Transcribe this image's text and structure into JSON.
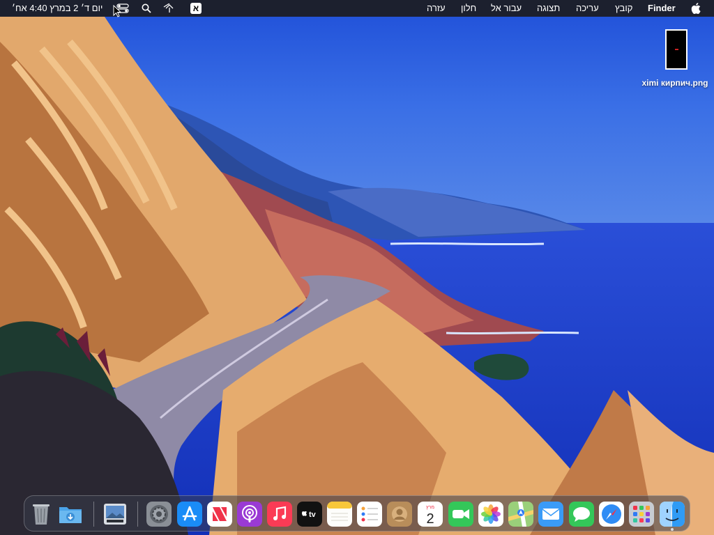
{
  "menubar": {
    "apple_icon": "apple-logo-icon",
    "app_name": "Finder",
    "menus": [
      "קובץ",
      "עריכה",
      "תצוגה",
      "עבור אל",
      "חלון",
      "עזרה"
    ],
    "input_source": "א",
    "clock": "יום ד׳ 2 במרץ 4:40 אח׳",
    "status_icons": [
      "control-center-icon",
      "search-icon",
      "wifi-icon",
      "input-source-icon"
    ]
  },
  "desktop": {
    "file_name": "ximi кирпич.png"
  },
  "dock": {
    "calendar_month": "מרץ",
    "calendar_day": "2",
    "tv_label": "tv",
    "apps": [
      {
        "name": "Finder",
        "icon": "finder-icon",
        "running": true
      },
      {
        "name": "Launchpad",
        "icon": "launchpad-icon"
      },
      {
        "name": "Safari",
        "icon": "safari-icon"
      },
      {
        "name": "Messages",
        "icon": "messages-icon"
      },
      {
        "name": "Mail",
        "icon": "mail-icon"
      },
      {
        "name": "Maps",
        "icon": "maps-icon"
      },
      {
        "name": "Photos",
        "icon": "photos-icon"
      },
      {
        "name": "FaceTime",
        "icon": "facetime-icon"
      },
      {
        "name": "Calendar",
        "icon": "calendar-icon"
      },
      {
        "name": "Contacts",
        "icon": "contacts-icon"
      },
      {
        "name": "Reminders",
        "icon": "reminders-icon"
      },
      {
        "name": "Notes",
        "icon": "notes-icon"
      },
      {
        "name": "TV",
        "icon": "apple-tv-icon"
      },
      {
        "name": "Music",
        "icon": "music-icon"
      },
      {
        "name": "Podcasts",
        "icon": "podcasts-icon"
      },
      {
        "name": "News",
        "icon": "news-icon"
      },
      {
        "name": "App Store",
        "icon": "app-store-icon"
      },
      {
        "name": "System Preferences",
        "icon": "system-preferences-icon"
      },
      {
        "name": "Preview",
        "icon": "preview-icon"
      },
      {
        "name": "Downloads",
        "icon": "downloads-folder-icon"
      },
      {
        "name": "Trash",
        "icon": "trash-icon"
      }
    ]
  },
  "colors": {
    "sky": "#1f55e0",
    "sea": "#1c3fd0",
    "cliff": "#e2a86c",
    "road": "#8f8aa6",
    "menubar": "#1c1c20"
  }
}
